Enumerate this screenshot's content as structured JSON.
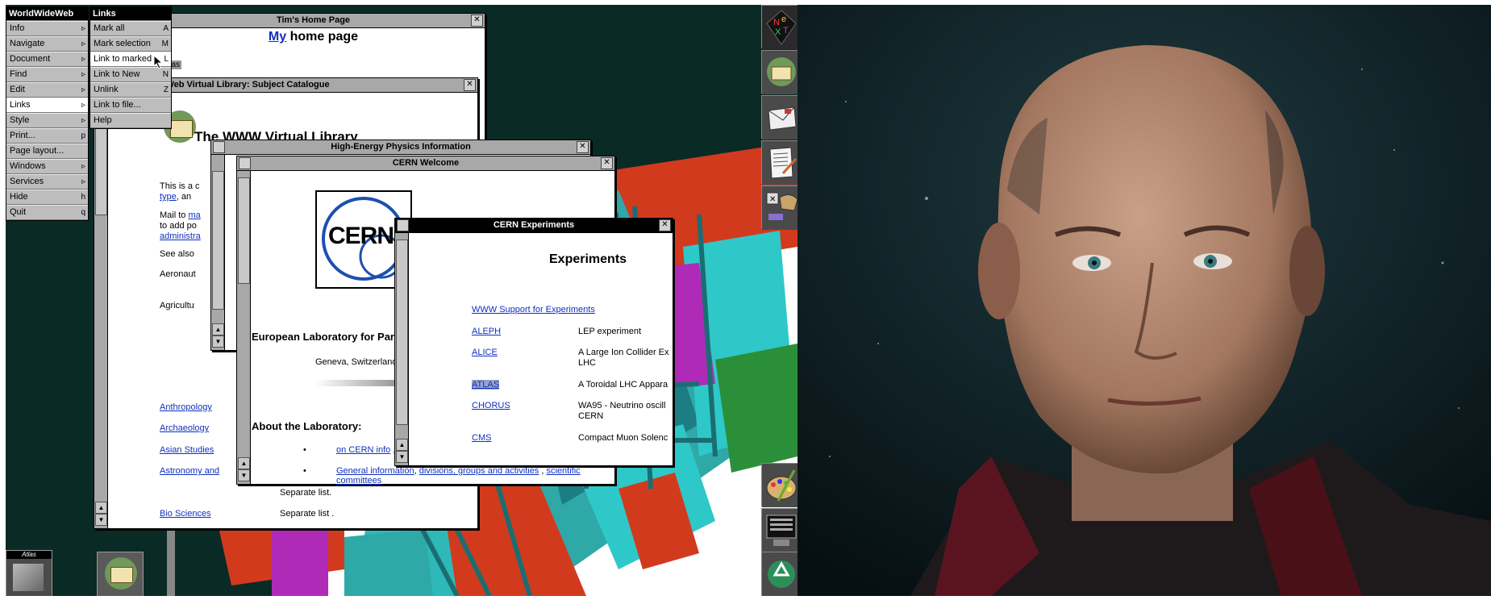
{
  "main_menu": {
    "title": "WorldWideWeb",
    "items": [
      {
        "label": "Info",
        "key": "▹"
      },
      {
        "label": "Navigate",
        "key": "▹"
      },
      {
        "label": "Document",
        "key": "▹"
      },
      {
        "label": "Find",
        "key": "▹"
      },
      {
        "label": "Edit",
        "key": "▹"
      },
      {
        "label": "Links",
        "key": "▹"
      },
      {
        "label": "Style",
        "key": "▹"
      },
      {
        "label": "Print...",
        "key": "p"
      },
      {
        "label": "Page layout...",
        "key": ""
      },
      {
        "label": "Windows",
        "key": "▹"
      },
      {
        "label": "Services",
        "key": "▹"
      },
      {
        "label": "Hide",
        "key": "h"
      },
      {
        "label": "Quit",
        "key": "q"
      }
    ]
  },
  "links_menu": {
    "title": "Links",
    "items": [
      {
        "label": "Mark all",
        "key": "A"
      },
      {
        "label": "Mark selection",
        "key": "M"
      },
      {
        "label": "Link to marked",
        "key": "L"
      },
      {
        "label": "Link to New",
        "key": "N"
      },
      {
        "label": "Unlink",
        "key": "Z"
      },
      {
        "label": "Link to file...",
        "key": ""
      },
      {
        "label": "Help",
        "key": ""
      }
    ]
  },
  "tims": {
    "title": "Tim's Home Page",
    "heading_link": "My",
    "heading_rest": " home page",
    "mark": "atlas"
  },
  "vlib": {
    "title": "The World-Wide Web Virtual Library: Subject Catalogue",
    "heading": "The WWW Virtual Library",
    "t1": "This is a c",
    "t2l": "type",
    "t2r": ", an",
    "t3": "Mail to ",
    "t3l": "ma",
    "t4": "to add po",
    "t5l": "administra",
    "t6": "See also",
    "c1": "Aeronaut",
    "c2": "Agricultu",
    "subjects": [
      {
        "name": "Anthropology",
        "note": ""
      },
      {
        "name": "Archaeology",
        "note": ""
      },
      {
        "name": "Asian Studies",
        "note": ""
      },
      {
        "name": "Astronomy and",
        "note": ""
      },
      {
        "name": "",
        "note": "Separate list."
      },
      {
        "name": "Bio Sciences",
        "note": "Separate list ."
      }
    ]
  },
  "hep": {
    "title": "High-Energy Physics Information"
  },
  "cern": {
    "title": "CERN Welcome",
    "logo": "CERN",
    "lab": "European Laboratory for Part",
    "place": "Geneva, Switzerland",
    "about": "About the Laboratory:",
    "b1": "on CERN info",
    "b1r": " ,",
    "b2a": "General information",
    "b2b": "divisions, groups and activities",
    "b2c": "scientific",
    "b2d": "committees"
  },
  "exp": {
    "title": "CERN Experiments",
    "heading": "Experiments",
    "support": "WWW Support for Experiments",
    "rows": [
      {
        "name": "ALEPH",
        "desc": "LEP experiment",
        "desc2": ""
      },
      {
        "name": "ALICE",
        "desc": "A Large Ion Collider Ex",
        "desc2": "LHC"
      },
      {
        "name": "ATLAS",
        "desc": "A Toroidal LHC Appara",
        "desc2": ""
      },
      {
        "name": "CHORUS",
        "desc": "WA95 - Neutrino oscill",
        "desc2": "CERN"
      },
      {
        "name": "CMS",
        "desc": "Compact Muon Solenc",
        "desc2": ""
      }
    ]
  },
  "atlas_tile": "Atlas"
}
